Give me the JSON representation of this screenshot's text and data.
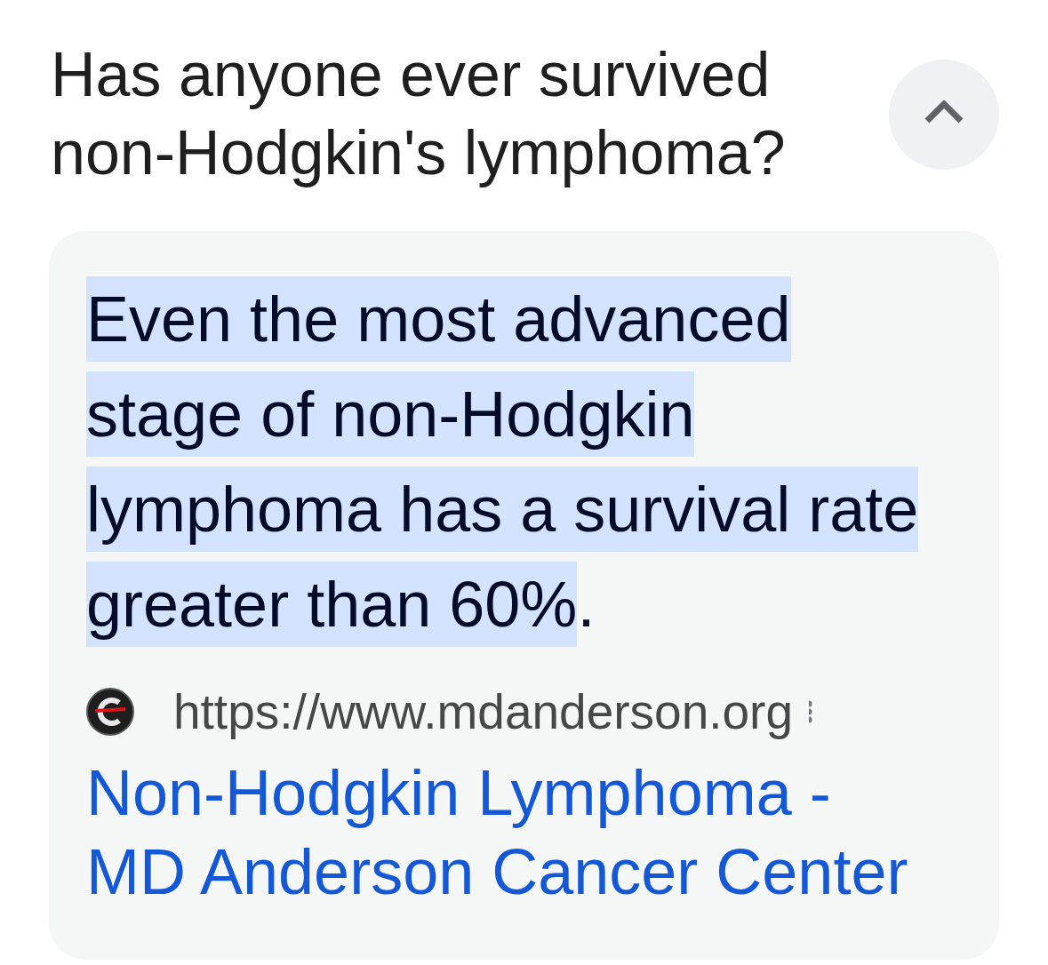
{
  "question": {
    "text": "Has anyone ever survived non-Hodgkin's lymphoma?",
    "expanded": true
  },
  "answer": {
    "highlighted": "Even the most advanced stage of non-Hodgkin lymphoma has a survival rate greater than 60%",
    "rest": "."
  },
  "source": {
    "url": "https://www.mdanderson.org",
    "title": "Non-Hodgkin Lymphoma - MD Anderson Cancer Center"
  }
}
